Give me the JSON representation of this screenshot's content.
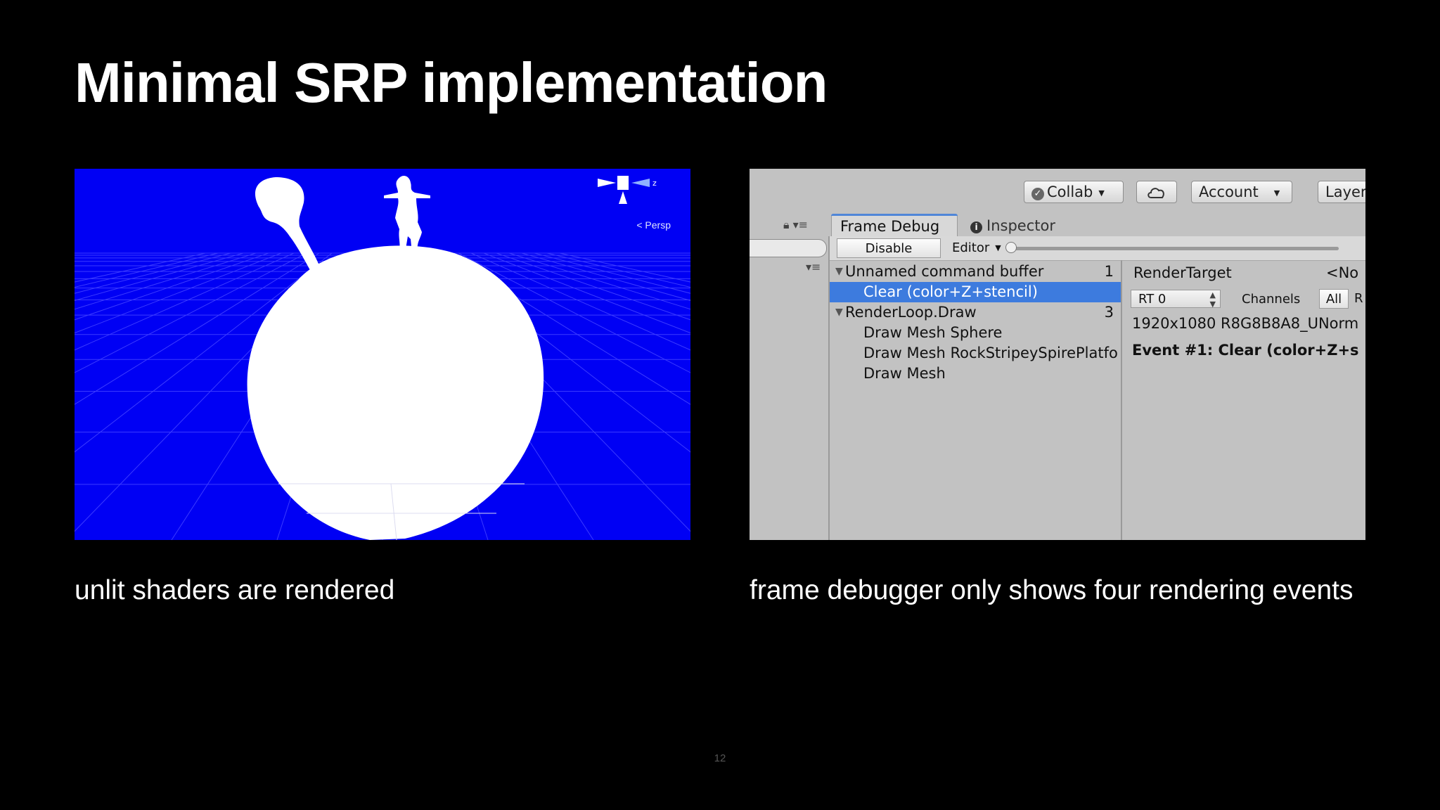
{
  "slide": {
    "title": "Minimal SRP implementation",
    "page_number": "12"
  },
  "left": {
    "scene_colors": {
      "background": "#0000f4",
      "silhouette": "#ffffff",
      "grid": "#3a3aff"
    },
    "persp_label": "Persp",
    "gizmo_axis": "z",
    "caption": "unlit shaders are rendered"
  },
  "right": {
    "toolbar": {
      "collab_label": "Collab",
      "cloud_icon": "cloud-icon",
      "account_label": "Account",
      "layers_label": "Layer"
    },
    "tabs": [
      {
        "label": "Frame Debug"
      },
      {
        "label": "Inspector"
      }
    ],
    "fd_toolbar": {
      "disable_label": "Disable",
      "editor_label": "Editor",
      "slider_value": "1"
    },
    "events": [
      {
        "label": "Unnamed command buffer",
        "count": "1",
        "expanded": true,
        "indent": 0
      },
      {
        "label": "Clear (color+Z+stencil)",
        "count": "",
        "selected": true,
        "indent": 1
      },
      {
        "label": "RenderLoop.Draw",
        "count": "3",
        "expanded": true,
        "indent": 0
      },
      {
        "label": "Draw Mesh Sphere",
        "count": "",
        "indent": 1
      },
      {
        "label": "Draw Mesh RockStripeySpirePlatfo",
        "count": "",
        "indent": 1
      },
      {
        "label": "Draw Mesh",
        "count": "",
        "indent": 1
      }
    ],
    "details": {
      "render_target_label": "RenderTarget",
      "render_target_value": "<No",
      "rt_select": "RT 0",
      "channels_label": "Channels",
      "all_label": "All",
      "r_label": "R",
      "format": "1920x1080 R8G8B8A8_UNorm",
      "event_title": "Event #1: Clear (color+Z+s"
    },
    "caption": "frame debugger only shows four rendering events"
  }
}
